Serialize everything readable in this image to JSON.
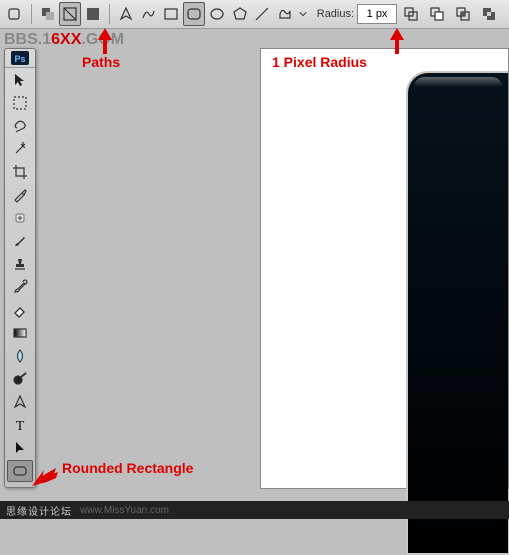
{
  "topbar": {
    "radius_label": "Radius:",
    "radius_value": "1 px"
  },
  "watermark": {
    "pre": "BBS.1",
    "xx": "6XX",
    "post": ".GOM"
  },
  "annotations": {
    "paths": "Paths",
    "radius": "1 Pixel Radius",
    "rounded": "Rounded Rectangle"
  },
  "footer": {
    "text": "思缘设计论坛",
    "url": "www.MissYuan.com"
  },
  "chart_data": null
}
